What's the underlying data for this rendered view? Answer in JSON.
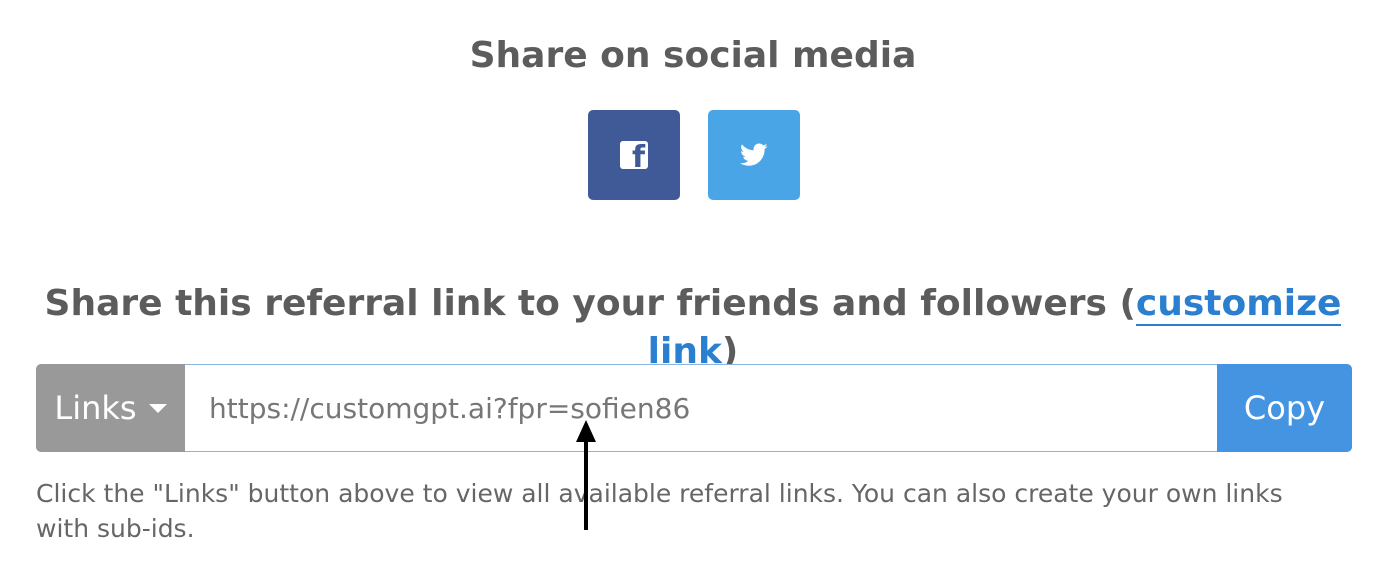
{
  "social": {
    "title": "Share on social media",
    "facebook": {
      "icon": "facebook-icon",
      "color": "#3f5a96",
      "glyph": "f"
    },
    "twitter": {
      "icon": "twitter-bird-icon",
      "color": "#4aa5e6"
    }
  },
  "referral": {
    "title_prefix": "Share this referral link to your friends and followers (",
    "customize_label": "customize link",
    "title_suffix": ")",
    "links_button": "Links",
    "url_value": "https://customgpt.ai?fpr=sofien86",
    "copy_button": "Copy",
    "help_text": "Click the \"Links\" button above to view all available referral links. You can also create your own links with sub-ids."
  },
  "colors": {
    "link_blue": "#2a7fd0",
    "copy_blue": "#4594e1",
    "links_gray": "#999999"
  }
}
